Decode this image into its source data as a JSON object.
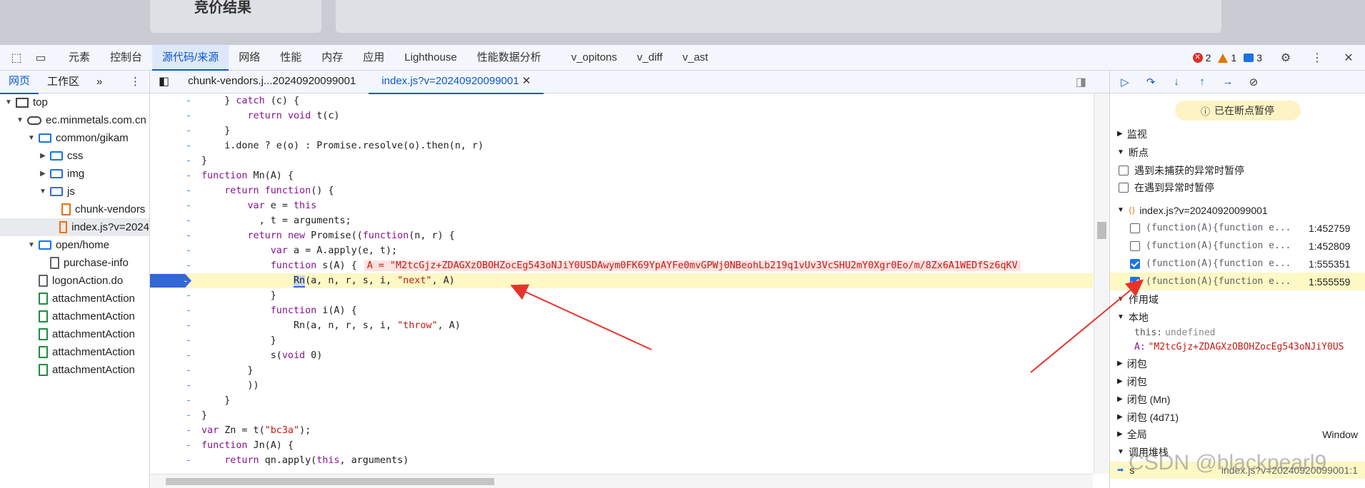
{
  "page_strip": {
    "left_card_text": "竞价结果"
  },
  "tabbar": {
    "tabs": [
      "元素",
      "控制台",
      "源代码/来源",
      "网络",
      "性能",
      "内存",
      "应用",
      "Lighthouse",
      "性能数据分析",
      "v_opitons",
      "v_diff",
      "v_ast"
    ],
    "active_tab_index": 2,
    "errors": "2",
    "warnings": "1",
    "messages": "3"
  },
  "navigator": {
    "tabs": [
      "网页",
      "工作区"
    ],
    "tree": [
      {
        "label": "top",
        "depth": 0,
        "icon": "frame-icon",
        "caret": "▼"
      },
      {
        "label": "ec.minmetals.com.cn",
        "depth": 1,
        "icon": "cloud-icon",
        "caret": "▼"
      },
      {
        "label": "common/gikam",
        "depth": 2,
        "icon": "folder-icon",
        "caret": "▼"
      },
      {
        "label": "css",
        "depth": 3,
        "icon": "folder-icon",
        "caret": "▶"
      },
      {
        "label": "img",
        "depth": 3,
        "icon": "folder-icon",
        "caret": "▶"
      },
      {
        "label": "js",
        "depth": 3,
        "icon": "folder-icon",
        "caret": "▼"
      },
      {
        "label": "chunk-vendors",
        "depth": 4,
        "icon": "file-orange-icon",
        "caret": ""
      },
      {
        "label": "index.js?v=2024",
        "depth": 4,
        "icon": "file-orange-icon",
        "caret": "",
        "selected": true
      },
      {
        "label": "open/home",
        "depth": 2,
        "icon": "folder-icon",
        "caret": "▼"
      },
      {
        "label": "purchase-info",
        "depth": 3,
        "icon": "file-icon",
        "caret": ""
      },
      {
        "label": "logonAction.do",
        "depth": 2,
        "icon": "file-icon",
        "caret": ""
      },
      {
        "label": "attachmentAction",
        "depth": 2,
        "icon": "file-green-icon",
        "caret": ""
      },
      {
        "label": "attachmentAction",
        "depth": 2,
        "icon": "file-green-icon",
        "caret": ""
      },
      {
        "label": "attachmentAction",
        "depth": 2,
        "icon": "file-green-icon",
        "caret": ""
      },
      {
        "label": "attachmentAction",
        "depth": 2,
        "icon": "file-green-icon",
        "caret": ""
      },
      {
        "label": "attachmentAction",
        "depth": 2,
        "icon": "file-green-icon",
        "caret": ""
      }
    ]
  },
  "editor": {
    "tabs": [
      {
        "label": "chunk-vendors.j...20240920099001",
        "active": false
      },
      {
        "label": "index.js?v=20240920099001",
        "active": true,
        "closable": true
      }
    ],
    "lines": [
      {
        "gutter": "-",
        "code": "    } catch (c) {"
      },
      {
        "gutter": "-",
        "code": "        return void t(c)"
      },
      {
        "gutter": "-",
        "code": "    }"
      },
      {
        "gutter": "-",
        "code": "    i.done ? e(o) : Promise.resolve(o).then(n, r)"
      },
      {
        "gutter": "-",
        "code": "}"
      },
      {
        "gutter": "-",
        "code": "function Mn(A) {"
      },
      {
        "gutter": "-",
        "code": "    return function() {"
      },
      {
        "gutter": "-",
        "code": "        var e = this"
      },
      {
        "gutter": "-",
        "code": "          , t = arguments;"
      },
      {
        "gutter": "-",
        "code": "        return new Promise((function(n, r) {"
      },
      {
        "gutter": "-",
        "code": "            var a = A.apply(e, t);"
      },
      {
        "gutter": "-",
        "code": "            function s(A) {",
        "inline": "A = \"M2tcGjz+ZDAGXzOBOHZocEg543oNJiY0USDAwym0FK69YpAYFe0mvGPWj0NBeohLb219q1vUv3VcSHU2mY0Xgr0Eo/m/8Zx6A1WEDfSz6qKV"
      },
      {
        "gutter": "-",
        "code": "                Rn(a, n, r, s, i, \"next\", A)",
        "breakpoint": true
      },
      {
        "gutter": "-",
        "code": "            }"
      },
      {
        "gutter": "-",
        "code": "            function i(A) {"
      },
      {
        "gutter": "-",
        "code": "                Rn(a, n, r, s, i, \"throw\", A)"
      },
      {
        "gutter": "-",
        "code": "            }"
      },
      {
        "gutter": "-",
        "code": "            s(void 0)"
      },
      {
        "gutter": "-",
        "code": "        }"
      },
      {
        "gutter": "-",
        "code": "        ))"
      },
      {
        "gutter": "-",
        "code": "    }"
      },
      {
        "gutter": "-",
        "code": "}"
      },
      {
        "gutter": "-",
        "code": "var Zn = t(\"bc3a\");"
      },
      {
        "gutter": "-",
        "code": "function Jn(A) {"
      },
      {
        "gutter": "-",
        "code": "    return qn.apply(this, arguments)"
      }
    ]
  },
  "debugger": {
    "paused_label": "已在断点暂停",
    "sections": {
      "watch": "监视",
      "breakpoints": "断点",
      "scope": "作用域",
      "callstack": "调用堆栈"
    },
    "pause_options": [
      "遇到未捕获的异常时暂停",
      "在遇到异常时暂停"
    ],
    "bp_file": "index.js?v=20240920099001",
    "breakpoints": [
      {
        "code": "(function(A){function e...",
        "loc": "1:452759",
        "checked": false
      },
      {
        "code": "(function(A){function e...",
        "loc": "1:452809",
        "checked": false
      },
      {
        "code": "(function(A){function e...",
        "loc": "1:555351",
        "checked": true
      },
      {
        "code": "(function(A){function e...",
        "loc": "1:555559",
        "checked": true,
        "active": true
      }
    ],
    "scope": {
      "local_label": "本地",
      "this_key": "this:",
      "this_val": "undefined",
      "a_key": "A:",
      "a_val": "\"M2tcGjz+ZDAGXzOBOHZocEg543oNJiY0US",
      "closures": [
        "闭包",
        "闭包",
        "闭包 (Mn)",
        "闭包 (4d71)"
      ],
      "global_label": "全局",
      "global_val": "Window"
    },
    "callstack_top": {
      "name": "s",
      "loc": "index.js?v=20240920099001:1"
    }
  },
  "watermark": "CSDN @blackpearl9",
  "colors": {
    "accent": "#0b57d0",
    "breakpoint_line": "#fdf8c4",
    "arrow": "#e8332a"
  }
}
